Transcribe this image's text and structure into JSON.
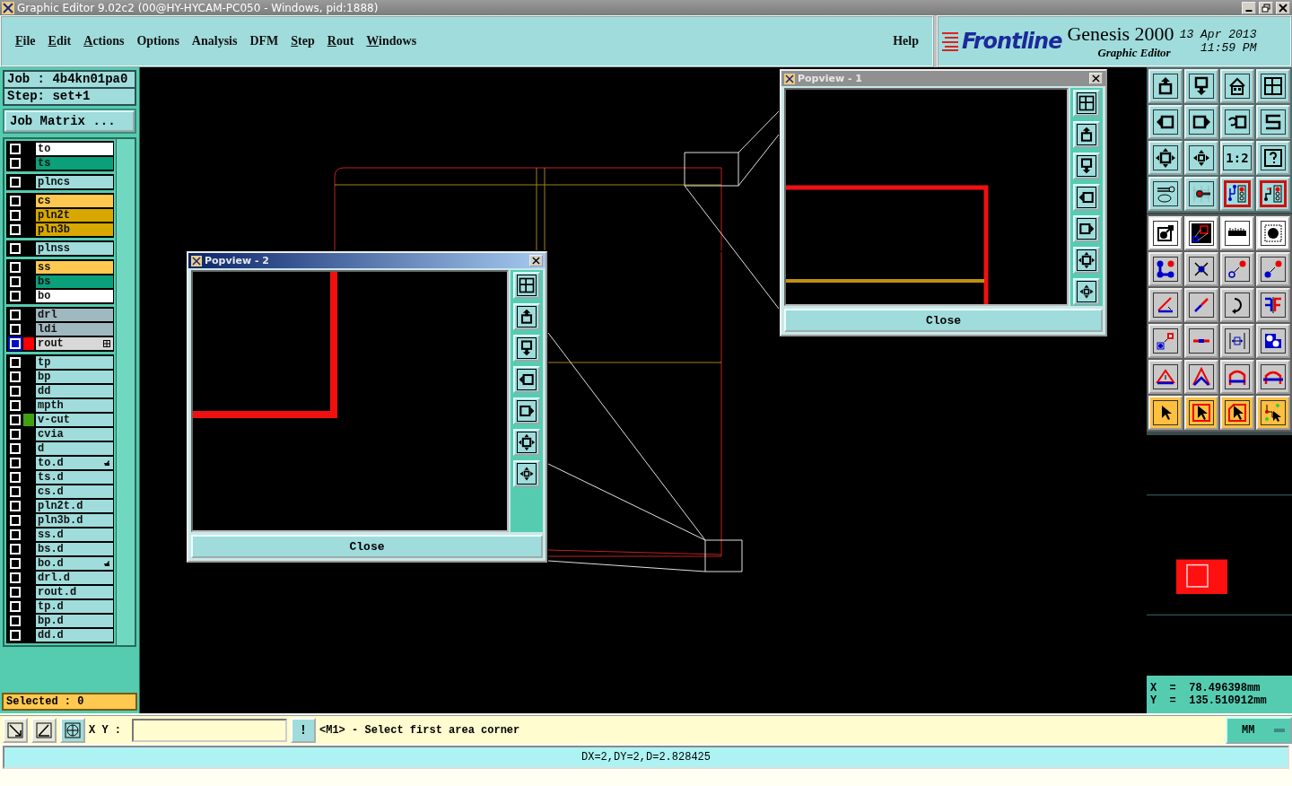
{
  "window": {
    "title": "Graphic Editor 9.02c2 (00@HY-HYCAM-PC050 - Windows, pid:1888)"
  },
  "menu": [
    {
      "label": "File",
      "underlined": true
    },
    {
      "label": "Edit",
      "underlined": true
    },
    {
      "label": "Actions",
      "underlined": true
    },
    {
      "label": "Options",
      "underlined": false
    },
    {
      "label": "Analysis",
      "underlined": false
    },
    {
      "label": "DFM",
      "underlined": false
    },
    {
      "label": "Step",
      "underlined": true
    },
    {
      "label": "Rout",
      "underlined": true
    },
    {
      "label": "Windows",
      "underlined": true
    }
  ],
  "help": {
    "label": "Help",
    "underlined": false
  },
  "brand": {
    "logo": "Frontline",
    "product": "Genesis 2000",
    "module": "Graphic Editor",
    "date": "13 Apr 2013",
    "time": "11:59 PM"
  },
  "job": {
    "job": "Job : 4b4kn01pa0",
    "step": "Step: set+1",
    "matrix_button": "Job Matrix ..."
  },
  "layer_groups": [
    {
      "layers": [
        {
          "name": "to",
          "color": "#ffffff",
          "selected": false
        },
        {
          "name": "ts",
          "color": "#0aa07a",
          "selected": false
        }
      ]
    },
    {
      "layers": [
        {
          "name": "plncs",
          "color": "#a0dcdc",
          "selected": false
        }
      ]
    },
    {
      "layers": [
        {
          "name": "cs",
          "color": "#ffc850",
          "selected": false
        },
        {
          "name": "pln2t",
          "color": "#d8a800",
          "selected": false
        },
        {
          "name": "pln3b",
          "color": "#d8a800",
          "selected": false
        }
      ]
    },
    {
      "layers": [
        {
          "name": "plnss",
          "color": "#a0dcdc",
          "selected": false
        }
      ]
    },
    {
      "layers": [
        {
          "name": "ss",
          "color": "#ffc850",
          "selected": false
        },
        {
          "name": "bs",
          "color": "#0aa07a",
          "selected": false
        },
        {
          "name": "bo",
          "color": "#ffffff",
          "selected": false
        }
      ]
    },
    {
      "layers": [
        {
          "name": "drl",
          "color": "#a0b8c0",
          "selected": false
        },
        {
          "name": "ldi",
          "color": "#a0b8c0",
          "selected": false
        },
        {
          "name": "rout",
          "color": "#d8d8d8",
          "selected": true,
          "indicator": {
            "color": "#ff0000"
          },
          "marker": {
            "kind": "grid"
          }
        }
      ]
    },
    {
      "layers": [
        {
          "name": "tp",
          "color": "#a0dcdc",
          "selected": false
        },
        {
          "name": "bp",
          "color": "#a0dcdc",
          "selected": false
        },
        {
          "name": "dd",
          "color": "#a0dcdc",
          "selected": false
        },
        {
          "name": "mpth",
          "color": "#a0dcdc",
          "selected": false
        },
        {
          "name": "v-cut",
          "color": "#a0dcdc",
          "selected": false,
          "indicator": {
            "color": "#40a010"
          }
        },
        {
          "name": "cvia",
          "color": "#a0dcdc",
          "selected": false
        },
        {
          "name": "d",
          "color": "#a0dcdc",
          "selected": false
        },
        {
          "name": "to.d",
          "color": "#a0dcdc",
          "selected": false,
          "marker": {
            "kind": "hand"
          }
        },
        {
          "name": "ts.d",
          "color": "#a0dcdc",
          "selected": false
        },
        {
          "name": "cs.d",
          "color": "#a0dcdc",
          "selected": false
        },
        {
          "name": "pln2t.d",
          "color": "#a0dcdc",
          "selected": false
        },
        {
          "name": "pln3b.d",
          "color": "#a0dcdc",
          "selected": false
        },
        {
          "name": "ss.d",
          "color": "#a0dcdc",
          "selected": false
        },
        {
          "name": "bs.d",
          "color": "#a0dcdc",
          "selected": false
        },
        {
          "name": "bo.d",
          "color": "#a0dcdc",
          "selected": false,
          "marker": {
            "kind": "hand"
          }
        },
        {
          "name": "drl.d",
          "color": "#a0dcdc",
          "selected": false
        },
        {
          "name": "rout.d",
          "color": "#a0dcdc",
          "selected": false
        },
        {
          "name": "tp.d",
          "color": "#a0dcdc",
          "selected": false
        },
        {
          "name": "bp.d",
          "color": "#a0dcdc",
          "selected": false
        },
        {
          "name": "dd.d",
          "color": "#a0dcdc",
          "selected": false
        }
      ]
    }
  ],
  "selected_count": "Selected : 0",
  "tools": [
    {
      "kind": "icon",
      "selected": false
    },
    {
      "kind": "icon",
      "selected": false
    },
    {
      "kind": "icon",
      "selected": false
    },
    {
      "kind": "icon",
      "selected": false
    },
    {
      "kind": "icon",
      "selected": false
    },
    {
      "kind": "icon",
      "selected": false
    },
    {
      "kind": "icon",
      "selected": false
    },
    {
      "kind": "icon",
      "selected": false
    },
    {
      "kind": "icon",
      "selected": false
    },
    {
      "kind": "icon",
      "selected": false
    },
    {
      "kind": "text",
      "label": "1:2",
      "selected": false
    },
    {
      "kind": "icon",
      "selected": false
    },
    {
      "kind": "icon",
      "selected": false
    },
    {
      "kind": "icon",
      "selected": false
    },
    {
      "kind": "icon",
      "selected": true
    },
    {
      "kind": "icon",
      "selected": true
    },
    {
      "kind": "icon",
      "selected": false
    },
    {
      "kind": "icon",
      "selected": false
    },
    {
      "kind": "icon",
      "selected": false
    },
    {
      "kind": "icon",
      "selected": false
    },
    {
      "kind": "icon",
      "selected": false
    },
    {
      "kind": "icon",
      "selected": false
    },
    {
      "kind": "icon",
      "selected": false
    },
    {
      "kind": "icon",
      "selected": false
    },
    {
      "kind": "icon",
      "selected": false
    },
    {
      "kind": "icon",
      "selected": false
    },
    {
      "kind": "icon",
      "selected": false
    },
    {
      "kind": "icon",
      "selected": false
    },
    {
      "kind": "icon",
      "selected": false
    },
    {
      "kind": "icon",
      "selected": false
    },
    {
      "kind": "icon",
      "selected": false
    },
    {
      "kind": "icon",
      "selected": false
    },
    {
      "kind": "icon",
      "selected": false
    },
    {
      "kind": "icon",
      "selected": false
    },
    {
      "kind": "icon",
      "selected": false
    },
    {
      "kind": "icon",
      "selected": false
    },
    {
      "kind": "icon",
      "selected": false
    },
    {
      "kind": "icon",
      "selected": false
    },
    {
      "kind": "icon",
      "selected": false
    },
    {
      "kind": "icon",
      "selected": false
    }
  ],
  "coords": {
    "x": "X  =  78.496398mm",
    "y": "Y  =  135.510912mm"
  },
  "popviews": [
    {
      "title": "Popview - 1",
      "active": false,
      "close": "Close"
    },
    {
      "title": "Popview - 2",
      "active": true,
      "close": "Close"
    }
  ],
  "command": {
    "xy_label": "X Y :",
    "alert_button": "!",
    "prompt": "<M1> - Select first area corner",
    "units": "MM"
  },
  "status": "DX=2,DY=2,D=2.828425"
}
